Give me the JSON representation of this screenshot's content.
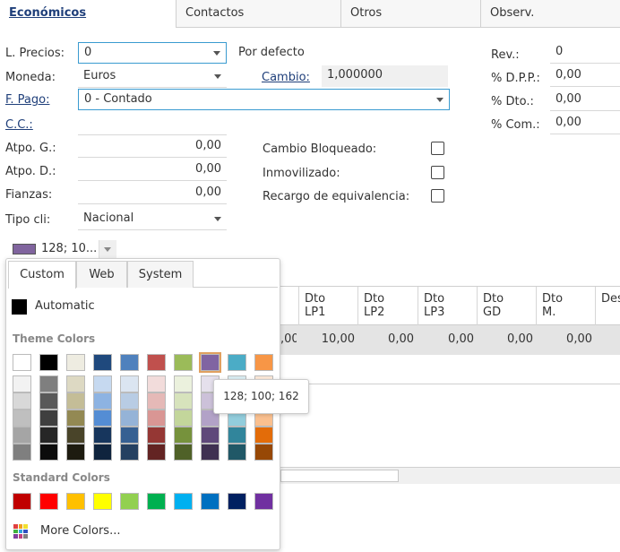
{
  "tabs": [
    {
      "label": "Económicos",
      "active": true
    },
    {
      "label": "Contactos",
      "active": false
    },
    {
      "label": "Otros",
      "active": false
    },
    {
      "label": "Observ.",
      "active": false
    }
  ],
  "form": {
    "l_precios": {
      "label": "L. Precios:",
      "value": "0",
      "note": "Por defecto"
    },
    "moneda": {
      "label": "Moneda:",
      "value": "Euros"
    },
    "cambio": {
      "label": "Cambio:",
      "value": "1,000000"
    },
    "f_pago": {
      "label": "F. Pago:",
      "value": "0 - Contado"
    },
    "cc": {
      "label": "C.C.:"
    },
    "atpo_g": {
      "label": "Atpo. G.:",
      "value": "0,00"
    },
    "atpo_d": {
      "label": "Atpo. D.:",
      "value": "0,00"
    },
    "fianzas": {
      "label": "Fianzas:",
      "value": "0,00"
    },
    "tipo_cli": {
      "label": "Tipo cli:",
      "value": "Nacional"
    },
    "rev": {
      "label": "Rev.:",
      "value": "0"
    },
    "dpp": {
      "label": "% D.P.P.:",
      "value": "0,00"
    },
    "dto": {
      "label": "% Dto.:",
      "value": "0,00"
    },
    "com": {
      "label": "% Com.:",
      "value": "0,00"
    },
    "cambio_bloqueado": {
      "label": "Cambio Bloqueado:",
      "checked": false
    },
    "inmovilizado": {
      "label": "Inmovilizado:",
      "checked": false
    },
    "recargo": {
      "label": "Recargo de equivalencia:",
      "checked": false
    }
  },
  "grid": {
    "headers": [
      {
        "l1": "",
        "l2": ""
      },
      {
        "l1": "Dto",
        "l2": "LP1"
      },
      {
        "l1": "Dto",
        "l2": "LP2"
      },
      {
        "l1": "Dto",
        "l2": "LP3"
      },
      {
        "l1": "Dto",
        "l2": "GD"
      },
      {
        "l1": "Dto",
        "l2": "M."
      },
      {
        "l1": "Des",
        "l2": ""
      }
    ],
    "row": [
      ",00",
      "10,00",
      "0,00",
      "0,00",
      "0,00",
      "0,00"
    ]
  },
  "color_selector": {
    "value_text": "128; 10...",
    "current_color": "#80649e"
  },
  "color_popup": {
    "tabs": [
      "Custom",
      "Web",
      "System"
    ],
    "active_tab": "Custom",
    "automatic_label": "Automatic",
    "theme_label": "Theme Colors",
    "standard_label": "Standard Colors",
    "more_label": "More Colors...",
    "tooltip": "128; 100; 162",
    "theme_top": [
      "#ffffff",
      "#000000",
      "#eeece1",
      "#1f497d",
      "#4f81bd",
      "#c0504d",
      "#9bbb59",
      "#8064a2",
      "#4bacc6",
      "#f79646"
    ],
    "theme_shades": [
      [
        "#f2f2f2",
        "#7f7f7f",
        "#ddd9c3",
        "#c6d9f0",
        "#dbe5f1",
        "#f2dcdb",
        "#ebf1dd",
        "#e5e0ec",
        "#dbeef3",
        "#fdeada"
      ],
      [
        "#d8d8d8",
        "#595959",
        "#c4bd97",
        "#8db3e2",
        "#b8cce4",
        "#e5b9b7",
        "#d7e3bc",
        "#ccc1d9",
        "#b7dde8",
        "#fbd5b5"
      ],
      [
        "#bfbfbf",
        "#3f3f3f",
        "#938953",
        "#548dd4",
        "#95b3d7",
        "#d99694",
        "#c3d69b",
        "#b2a2c7",
        "#92cddc",
        "#fac08f"
      ],
      [
        "#a5a5a5",
        "#262626",
        "#494429",
        "#17365d",
        "#366092",
        "#953734",
        "#76923c",
        "#5f497a",
        "#31859b",
        "#e36c09"
      ],
      [
        "#7f7f7f",
        "#0c0c0c",
        "#1d1b10",
        "#0f243e",
        "#244061",
        "#632423",
        "#4f6128",
        "#3f3151",
        "#205867",
        "#974806"
      ]
    ],
    "standard": [
      "#c00000",
      "#ff0000",
      "#ffc000",
      "#ffff00",
      "#92d050",
      "#00b050",
      "#00b0f0",
      "#0070c0",
      "#002060",
      "#7030a0"
    ],
    "selected_color": "#8064a2"
  }
}
